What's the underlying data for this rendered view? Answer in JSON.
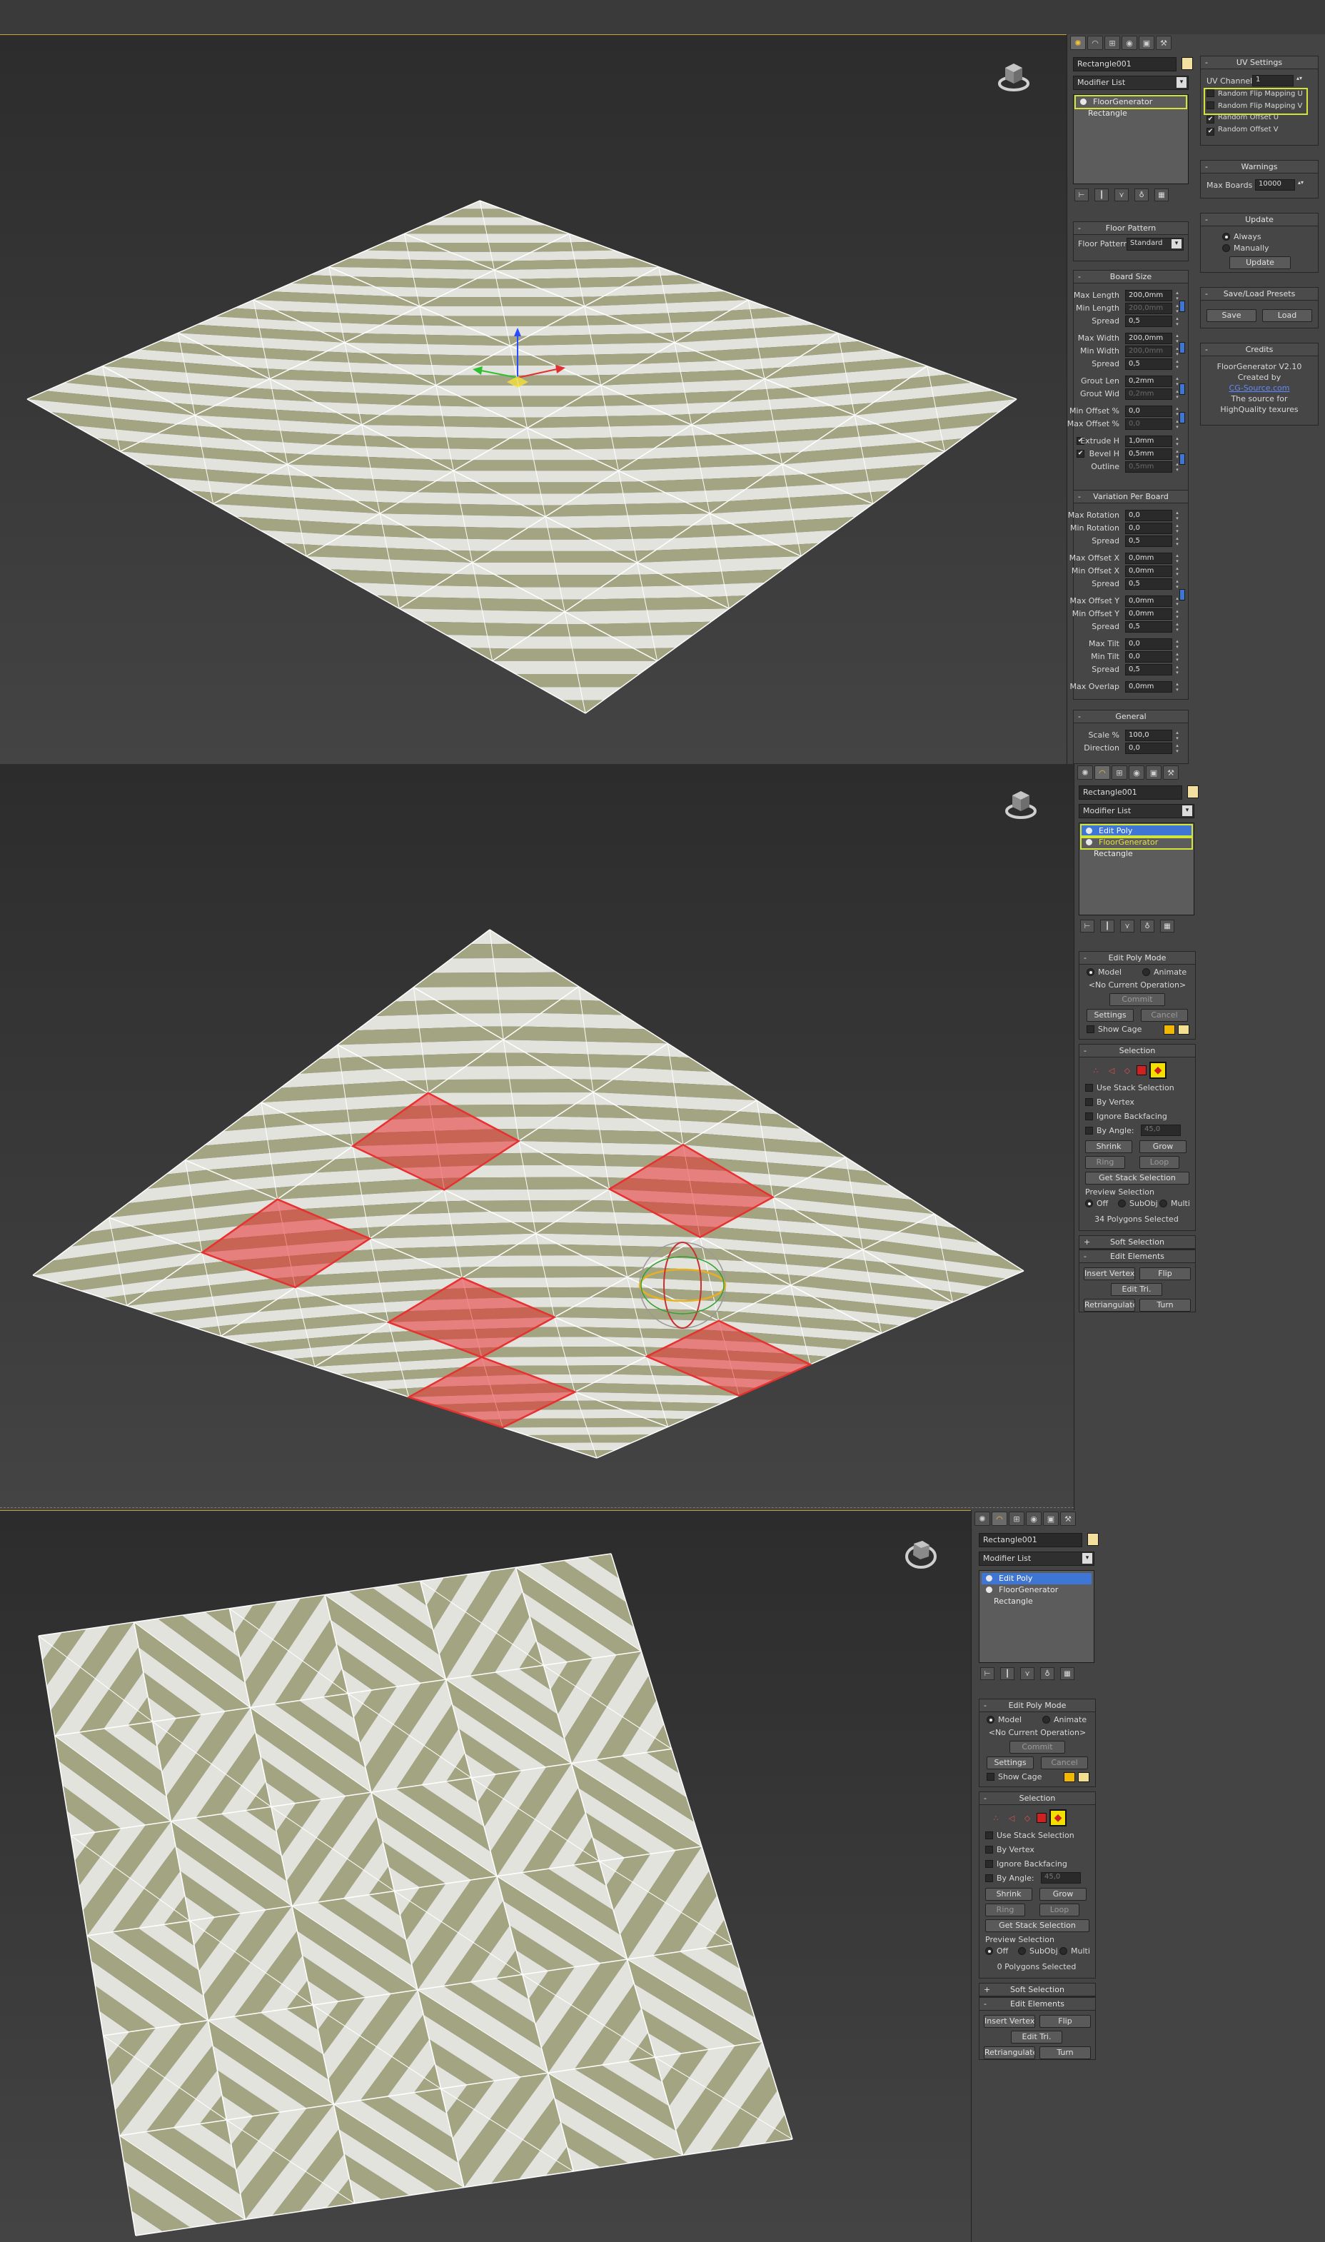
{
  "colors": {
    "stripe_green": "#a3a582",
    "stripe_light": "#e3e3dd",
    "board_line": "#ffffff",
    "selection_red": "#e83030",
    "highlight_yellow": "#d2e43a",
    "stack_selected": "#3f76d6",
    "panel_bg": "#444444"
  },
  "icons": {
    "tabs": [
      "create-icon",
      "modify-icon",
      "hierarchy-icon",
      "motion-icon",
      "display-icon",
      "utilities-icon"
    ]
  },
  "screen1": {
    "object_name": "Rectangle001",
    "modifier_list": "Modifier List",
    "stack": [
      "FloorGenerator",
      "Rectangle"
    ],
    "floor_pattern": {
      "title": "Floor Pattern",
      "label": "Floor Pattern",
      "value": "Standard"
    },
    "board_size": {
      "title": "Board Size",
      "rows": [
        {
          "label": "Max Length",
          "value": "200,0mm",
          "dim": false
        },
        {
          "label": "Min Length",
          "value": "200,0mm",
          "dim": true
        },
        {
          "label": "Spread",
          "value": "0,5",
          "dim": false
        },
        {
          "label": "Max Width",
          "value": "200,0mm",
          "dim": false
        },
        {
          "label": "Min Width",
          "value": "200,0mm",
          "dim": true
        },
        {
          "label": "Spread",
          "value": "0,5",
          "dim": false
        },
        {
          "label": "Grout Len",
          "value": "0,2mm",
          "dim": false
        },
        {
          "label": "Grout Wid",
          "value": "0,2mm",
          "dim": true
        },
        {
          "label": "Min Offset %",
          "value": "0,0",
          "dim": false
        },
        {
          "label": "Max Offset %",
          "value": "0,0",
          "dim": true
        },
        {
          "label": "Extrude H",
          "value": "1,0mm",
          "dim": false
        },
        {
          "label": "Bevel H",
          "value": "0,5mm",
          "dim": false
        },
        {
          "label": "Outline",
          "value": "0,5mm",
          "dim": true
        }
      ]
    },
    "variation": {
      "title": "Variation Per Board",
      "rows": [
        {
          "label": "Max Rotation",
          "value": "0,0"
        },
        {
          "label": "Min Rotation",
          "value": "0,0"
        },
        {
          "label": "Spread",
          "value": "0,5"
        },
        {
          "label": "Max Offset X",
          "value": "0,0mm"
        },
        {
          "label": "Min Offset X",
          "value": "0,0mm"
        },
        {
          "label": "Spread",
          "value": "0,5"
        },
        {
          "label": "Max Offset Y",
          "value": "0,0mm"
        },
        {
          "label": "Min Offset Y",
          "value": "0,0mm"
        },
        {
          "label": "Spread",
          "value": "0,5"
        },
        {
          "label": "Max Tilt",
          "value": "0,0"
        },
        {
          "label": "Min Tilt",
          "value": "0,0"
        },
        {
          "label": "Spread",
          "value": "0,5"
        },
        {
          "label": "Max Overlap",
          "value": "0,0mm"
        }
      ]
    },
    "general": {
      "title": "General",
      "rows": [
        {
          "label": "Scale %",
          "value": "100,0"
        },
        {
          "label": "Direction",
          "value": "0,0"
        }
      ]
    },
    "uv_settings": {
      "title": "UV Settings",
      "channel_label": "UV Channel",
      "channel_value": "1",
      "checks": [
        {
          "label": "Random Flip Mapping U",
          "checked": false
        },
        {
          "label": "Random Flip Mapping V",
          "checked": false
        },
        {
          "label": "Random Offset U",
          "checked": true
        },
        {
          "label": "Random Offset V",
          "checked": true
        }
      ]
    },
    "warnings": {
      "title": "Warnings",
      "label": "Max Boards",
      "value": "10000"
    },
    "update": {
      "title": "Update",
      "always": "Always",
      "manually": "Manually",
      "button": "Update"
    },
    "presets": {
      "title": "Save/Load Presets",
      "save": "Save",
      "load": "Load"
    },
    "credits": {
      "title": "Credits",
      "lines": [
        "FloorGenerator V2.10",
        "Created by"
      ],
      "link": "CG-Source.com",
      "lines2": [
        "The source for",
        "HighQuality texures"
      ]
    }
  },
  "editpoly": {
    "title": "Edit Poly Mode",
    "model": "Model",
    "animate": "Animate",
    "no_op": "<No Current Operation>",
    "commit": "Commit",
    "settings": "Settings",
    "cancel": "Cancel",
    "show_cage": "Show Cage",
    "selection_title": "Selection",
    "use_stack": "Use Stack Selection",
    "by_vertex": "By Vertex",
    "ignore_back": "Ignore Backfacing",
    "by_angle": "By Angle:",
    "by_angle_value": "45,0",
    "shrink": "Shrink",
    "grow": "Grow",
    "ring": "Ring",
    "loop": "Loop",
    "get_stack": "Get Stack Selection",
    "preview_title": "Preview Selection",
    "off": "Off",
    "subobj": "SubObj",
    "multi": "Multi",
    "soft_selection": "Soft Selection",
    "edit_elements": "Edit Elements",
    "insert_vertex": "Insert Vertex",
    "flip": "Flip",
    "edit_tri": "Edit Tri.",
    "retriangulate": "Retriangulate",
    "turn": "Turn"
  },
  "screen2": {
    "object_name": "Rectangle001",
    "modifier_list": "Modifier List",
    "stack": [
      "Edit Poly",
      "FloorGenerator",
      "Rectangle"
    ],
    "polygons_selected": "34 Polygons Selected"
  },
  "screen3": {
    "object_name": "Rectangle001",
    "modifier_list": "Modifier List",
    "stack": [
      "Edit Poly",
      "FloorGenerator",
      "Rectangle"
    ],
    "polygons_selected": "0 Polygons Selected"
  }
}
